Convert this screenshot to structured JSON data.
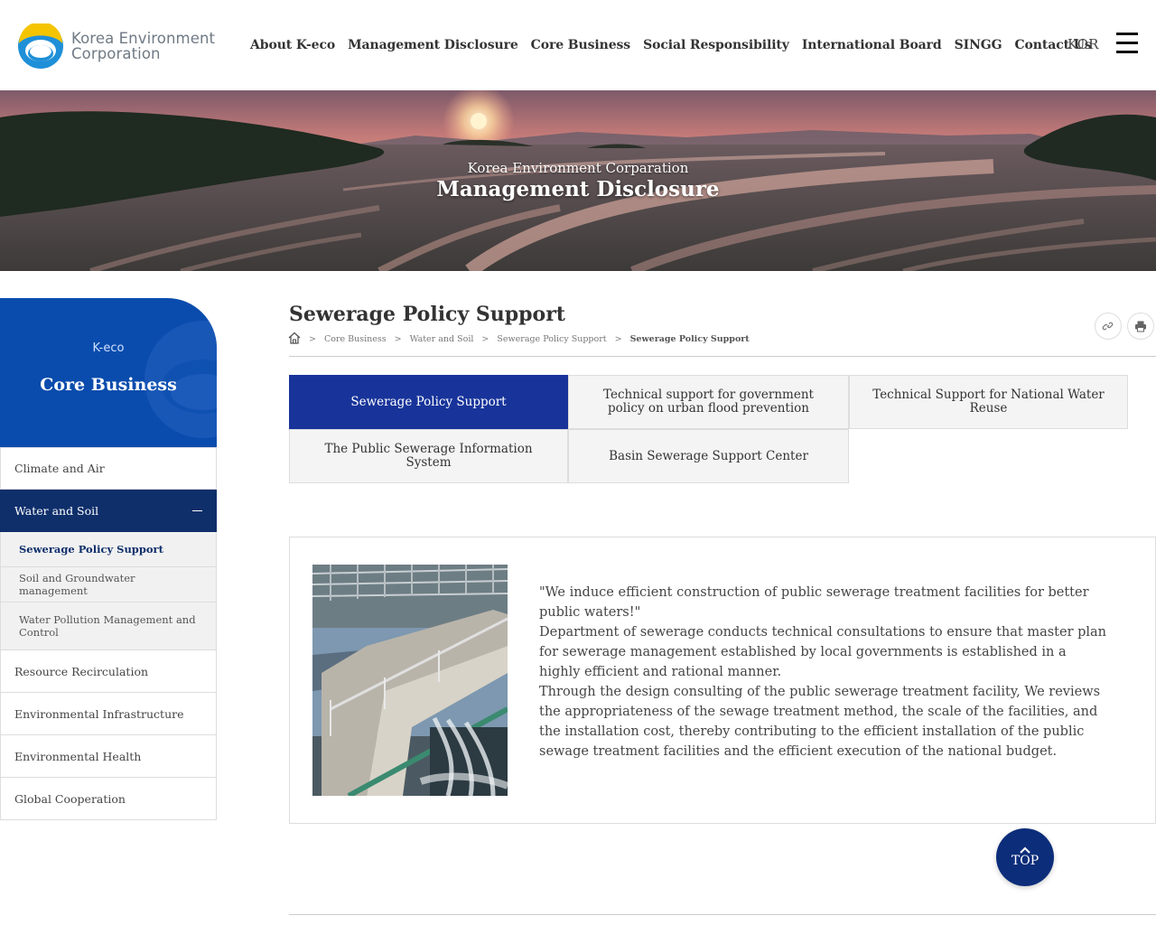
{
  "header": {
    "logo_line1": "Korea Environment",
    "logo_line2": "Corporation",
    "nav": [
      "About K-eco",
      "Management Disclosure",
      "Core Business",
      "Social Responsibility",
      "International Board",
      "SINGG",
      "Contact Us"
    ],
    "lang": "KOR"
  },
  "hero": {
    "subtitle": "Korea Environment Corparation",
    "title": "Management Disclosure"
  },
  "sidebar": {
    "brand": "K-eco",
    "title": "Core Business",
    "items": [
      "Climate and Air",
      "Water and Soil",
      "Resource Recirculation",
      "Environmental Infrastructure",
      "Environmental Health",
      "Global Cooperation"
    ],
    "subitems": [
      "Sewerage Policy Support",
      "Soil and Groundwater management",
      "Water Pollution Management and Control"
    ]
  },
  "page": {
    "title": "Sewerage Policy Support",
    "breadcrumb": [
      "Core Business",
      "Water and Soil",
      "Sewerage Policy Support",
      "Sewerage Policy Support"
    ],
    "breadcrumb_sep": ">"
  },
  "tabs": [
    "Sewerage Policy Support",
    "Technical support for government policy on urban flood prevention",
    "Technical Support for National Water Reuse",
    "The Public Sewerage Information System",
    "Basin Sewerage Support Center"
  ],
  "content": {
    "paragraphs": [
      "\"We induce efficient construction of public sewerage treatment facilities for better public waters!\"",
      "Department of sewerage conducts technical consultations to ensure that master plan for sewerage management established by local governments is established in a highly efficient and rational manner.",
      "Through the design consulting of the public sewerage treatment facility, We reviews the appropriateness of the sewage treatment method, the scale of the facilities, and the installation cost, thereby contributing to the efficient installation of the public sewage treatment facilities and the efficient execution of the national budget."
    ]
  },
  "top_button": "TOP",
  "icons": {
    "home": "home-icon",
    "link": "link-icon",
    "print": "print-icon",
    "menu": "hamburger-menu-icon",
    "up": "chevron-up-icon"
  },
  "colors": {
    "primary_navy": "#0f2f6b",
    "tab_active": "#18349a",
    "sidebar_blue": "#0a4cad",
    "top_button": "#0c2d7a"
  }
}
